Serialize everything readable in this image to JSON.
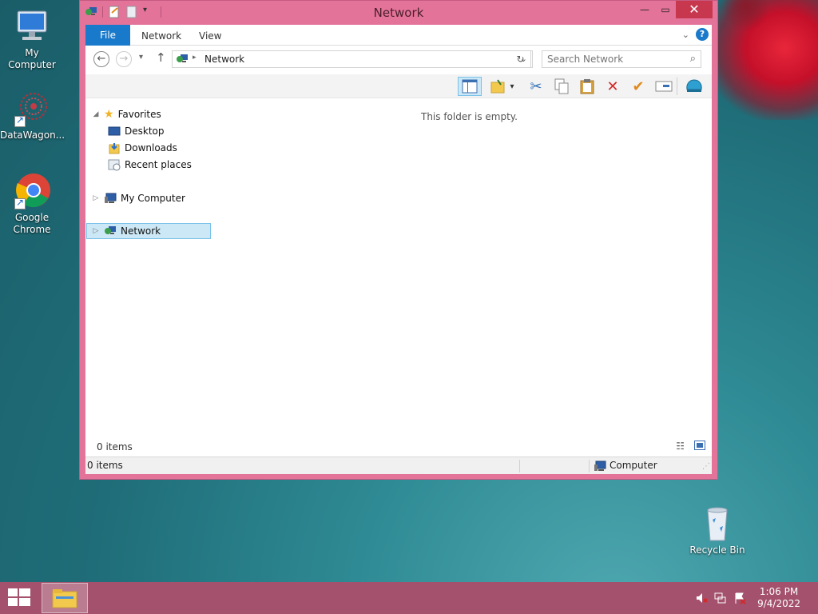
{
  "desktop": {
    "icons": [
      {
        "label": "My Computer"
      },
      {
        "label": "DataWagon..."
      },
      {
        "label": "Google Chrome"
      },
      {
        "label": "Recycle Bin"
      }
    ]
  },
  "window": {
    "title": "Network",
    "tabs": {
      "file": "File",
      "network": "Network",
      "view": "View"
    },
    "help": "?",
    "address": {
      "location": "Network"
    },
    "search": {
      "placeholder": "Search Network"
    },
    "empty_message": "This folder is empty.",
    "nav_pane": {
      "favorites": "Favorites",
      "desktop": "Desktop",
      "downloads": "Downloads",
      "recent": "Recent places",
      "my_computer": "My Computer",
      "network": "Network"
    },
    "item_count_top": "0 items",
    "status": {
      "items": "0 items",
      "zone": "Computer"
    }
  },
  "taskbar": {
    "time": "1:06 PM",
    "date": "9/4/2022"
  },
  "colors": {
    "window_frame": "#e4739a",
    "taskbar": "#a3516c",
    "file_tab": "#1979ca",
    "close_button": "#c7384f",
    "selection": "#cce8f6"
  }
}
